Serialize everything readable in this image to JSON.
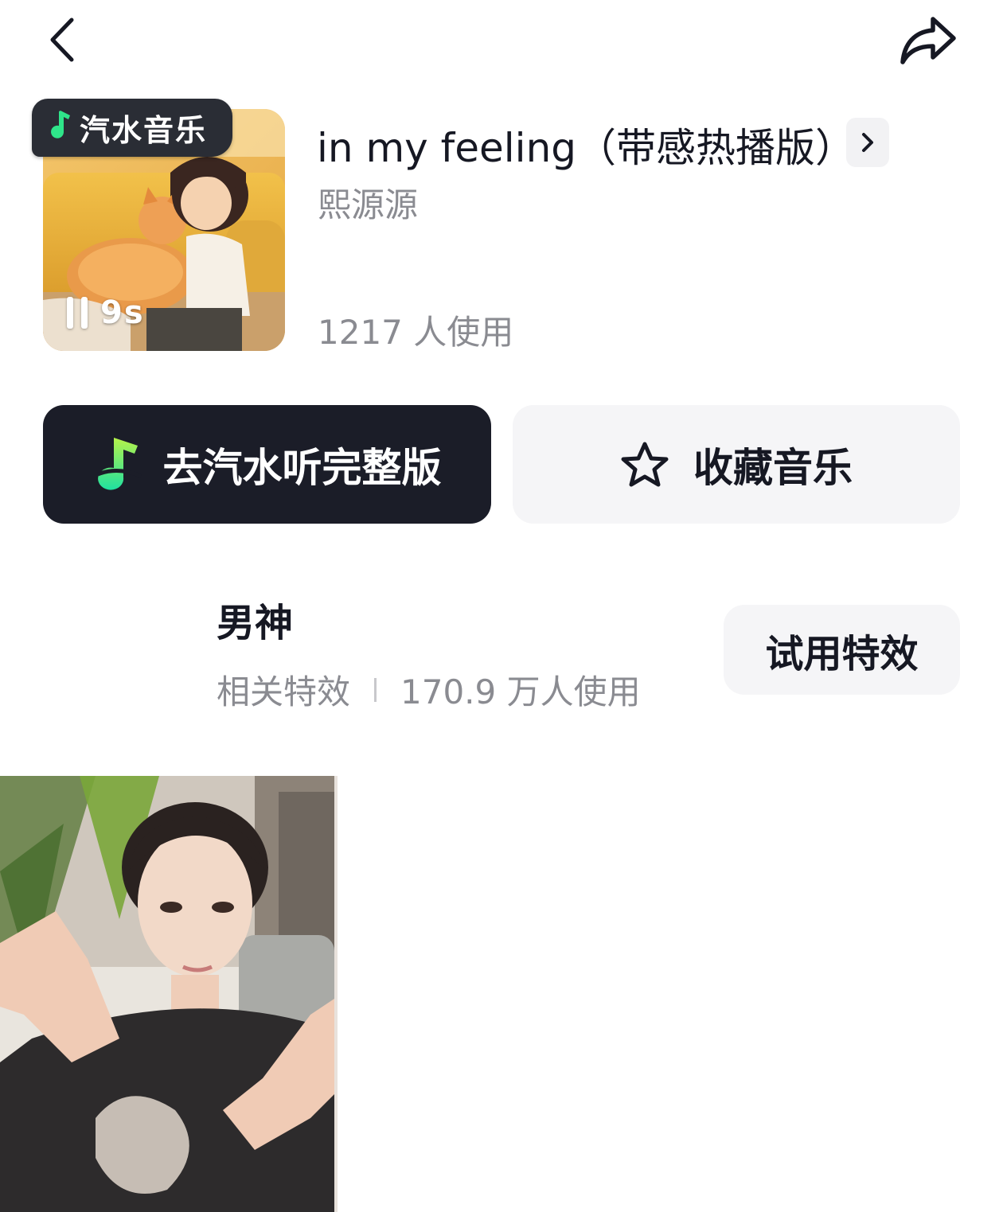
{
  "header": {
    "back_icon": "chevron-left-icon",
    "share_icon": "share-arrow-icon"
  },
  "music": {
    "badge_label": "汽水音乐",
    "duration": "9s",
    "title": "in my feeling（带感热播版）",
    "artist": "熙源源",
    "usage": "1217 人使用"
  },
  "actions": {
    "listen_label": "去汽水听完整版",
    "favorite_label": "收藏音乐"
  },
  "effect": {
    "name": "男神",
    "category": "相关特效",
    "usage": "170.9 万人使用",
    "try_label": "试用特效"
  },
  "colors": {
    "primary_button": "#1b1d28",
    "secondary_button": "#f5f5f7",
    "muted_text": "#8a8b91",
    "brand_green": "#2fe58a"
  }
}
